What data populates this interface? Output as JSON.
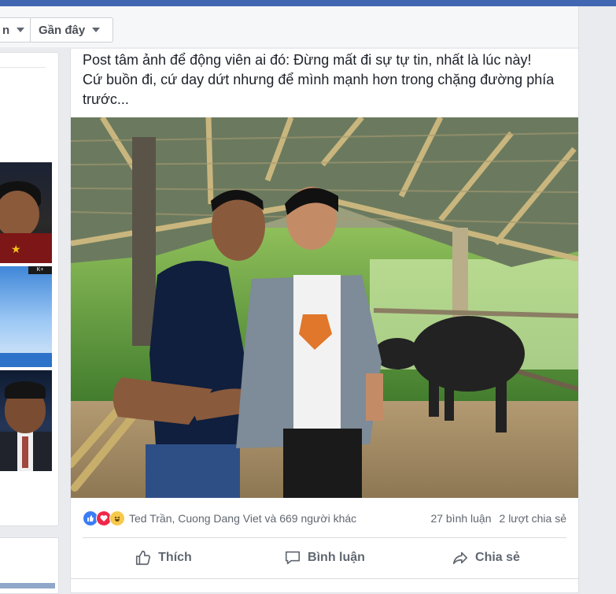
{
  "sort_bar": {
    "sort_partial_label": "n",
    "recent_label": "Gần đây"
  },
  "post": {
    "text": "Post tâm ảnh để động viên ai đó: Đừng mất đi sự tự tin, nhất là lúc này! Cứ buồn đi, cứ day dứt nhưng để mình mạnh hơn trong chặng đường phía trước...",
    "reactions": {
      "types": [
        "like",
        "love",
        "haha"
      ],
      "names": "Ted Trần, Cuong Dang Viet và 669 người khác",
      "comments": "27 bình luận",
      "shares": "2 lượt chia sẻ"
    },
    "actions": {
      "like": "Thích",
      "comment": "Bình luận",
      "share": "Chia sẻ"
    }
  },
  "sidebar": {
    "tv_logo_text": "K+"
  },
  "colors": {
    "brand": "#4267b2",
    "like_blue": "#3b7cf6",
    "love_red": "#f0284a",
    "haha_yellow": "#f7c94b"
  }
}
